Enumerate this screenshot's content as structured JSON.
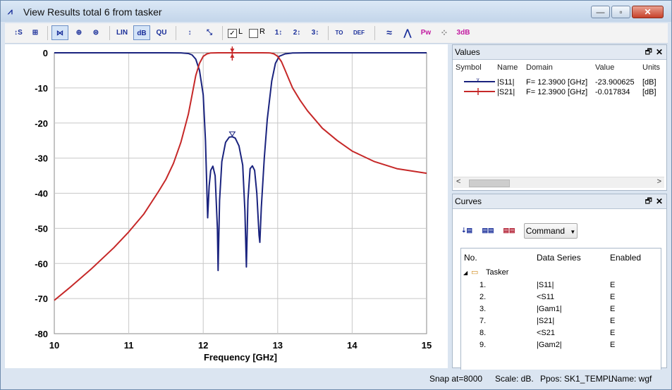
{
  "window": {
    "title": "View Results total 6 from tasker",
    "minimize_glyph": "—",
    "maximize_glyph": "▫",
    "close_glyph": "✕"
  },
  "toolbar": {
    "buttons": [
      {
        "icon": "axis-settings-icon",
        "label": "↕S"
      },
      {
        "icon": "zoom-fit-icon",
        "label": "⊞"
      },
      {
        "icon": "xy-plot-icon",
        "label": "⋈"
      },
      {
        "icon": "polar-plot-icon",
        "label": "⊕"
      },
      {
        "icon": "smith-chart-icon",
        "label": "⊜"
      },
      {
        "icon": "scale-linear-icon",
        "label": "LIN"
      },
      {
        "icon": "scale-db-icon",
        "label": "dB"
      },
      {
        "icon": "scale-unit-icon",
        "label": "QU"
      },
      {
        "icon": "marker-add-icon",
        "label": "↕"
      },
      {
        "icon": "marker-fit-icon",
        "label": "⤡"
      },
      {
        "icon": "marker-1-icon",
        "label": "1↕"
      },
      {
        "icon": "marker-2-icon",
        "label": "2↕"
      },
      {
        "icon": "marker-3-icon",
        "label": "3↕"
      },
      {
        "icon": "marker-to-icon",
        "label": "TO"
      },
      {
        "icon": "marker-def-icon",
        "label": "DEF"
      },
      {
        "icon": "wave-icon",
        "label": "≈"
      },
      {
        "icon": "peaks-icon",
        "label": "⋀"
      },
      {
        "icon": "power-wave-icon",
        "label": "Pw"
      },
      {
        "icon": "dots-icon",
        "label": "⁘"
      },
      {
        "icon": "3db-icon",
        "label": "3dB"
      }
    ],
    "check_l": {
      "label": "L",
      "checked": true,
      "mark": "✓"
    },
    "check_r": {
      "label": "R",
      "checked": false,
      "mark": ""
    }
  },
  "chart_data": {
    "type": "line",
    "xlabel": "Frequency [GHz]",
    "ylabel": "",
    "xlim": [
      10,
      15
    ],
    "ylim": [
      -80,
      0
    ],
    "xticks": [
      "10",
      "11",
      "12",
      "13",
      "14",
      "15"
    ],
    "yticks": [
      "0",
      "-10",
      "-20",
      "-30",
      "-40",
      "-50",
      "-60",
      "-70",
      "-80"
    ],
    "grid": true,
    "marker_x": 12.39,
    "series": [
      {
        "name": "|S11|",
        "color": "#1a237e",
        "x": [
          10.0,
          11.5,
          11.7,
          11.8,
          11.85,
          11.9,
          11.95,
          12.0,
          12.03,
          12.06,
          12.08,
          12.1,
          12.13,
          12.16,
          12.19,
          12.2,
          12.22,
          12.25,
          12.3,
          12.35,
          12.39,
          12.43,
          12.48,
          12.53,
          12.56,
          12.58,
          12.6,
          12.63,
          12.66,
          12.69,
          12.72,
          12.75,
          12.76,
          12.78,
          12.82,
          12.86,
          12.92,
          12.97,
          13.02,
          13.1,
          13.2,
          13.4,
          14.0,
          15.0
        ],
        "y": [
          0.0,
          0.0,
          -0.02,
          -0.2,
          -0.6,
          -1.8,
          -5.0,
          -12.0,
          -25.0,
          -47.0,
          -38.0,
          -33.5,
          -32.3,
          -35.0,
          -50.0,
          -62.0,
          -42.0,
          -31.0,
          -25.5,
          -24.0,
          -23.9,
          -24.3,
          -26.5,
          -32.0,
          -45.0,
          -61.0,
          -42.0,
          -33.0,
          -32.2,
          -33.5,
          -40.0,
          -52.0,
          -54.0,
          -44.0,
          -30.0,
          -19.0,
          -8.0,
          -3.0,
          -1.0,
          -0.3,
          -0.06,
          -0.01,
          0.0,
          0.0
        ]
      },
      {
        "name": "|S21|",
        "color": "#c62828",
        "x": [
          10.0,
          10.2,
          10.5,
          10.8,
          11.0,
          11.2,
          11.4,
          11.5,
          11.6,
          11.7,
          11.8,
          11.85,
          11.9,
          11.95,
          12.0,
          12.05,
          12.1,
          12.2,
          12.8,
          12.9,
          12.95,
          13.0,
          13.05,
          13.1,
          13.15,
          13.2,
          13.3,
          13.4,
          13.6,
          13.8,
          14.0,
          14.3,
          14.6,
          15.0
        ],
        "y": [
          -70.5,
          -67.0,
          -61.5,
          -55.5,
          -51.0,
          -46.0,
          -39.5,
          -36.0,
          -31.5,
          -25.5,
          -17.5,
          -12.0,
          -6.5,
          -3.0,
          -1.0,
          -0.3,
          -0.05,
          0.0,
          0.0,
          -0.05,
          -0.3,
          -1.0,
          -2.5,
          -5.0,
          -7.5,
          -10.0,
          -13.5,
          -16.5,
          -21.5,
          -25.0,
          -28.0,
          -31.0,
          -33.0,
          -34.3
        ]
      }
    ]
  },
  "values_panel": {
    "title": "Values",
    "columns": [
      "Symbol",
      "Name",
      "Domain",
      "Value",
      "Units"
    ],
    "rows": [
      {
        "name": "|S11|",
        "domain": "F= 12.3900 [GHz]",
        "value": "-23.900625",
        "units": "[dB]",
        "color": "#1a237e"
      },
      {
        "name": "|S21|",
        "domain": "F= 12.3900 [GHz]",
        "value": "-0.017834",
        "units": "[dB]",
        "color": "#c62828"
      }
    ],
    "pin_glyph": "🗗",
    "close_glyph": "✕",
    "scroll_left": "<",
    "scroll_right": ">"
  },
  "curves_panel": {
    "title": "Curves",
    "command_label": "Command",
    "command_arrow": "▼",
    "pin_glyph": "🗗",
    "close_glyph": "✕",
    "columns": [
      "No.",
      "Data Series",
      "Enabled"
    ],
    "folder": {
      "expander": "◢",
      "name": "Tasker"
    },
    "rows": [
      {
        "no": "1.",
        "series": "|S11|",
        "enabled": "E"
      },
      {
        "no": "2.",
        "series": "<S11",
        "enabled": "E"
      },
      {
        "no": "3.",
        "series": "|Gam1|",
        "enabled": "E"
      },
      {
        "no": "7.",
        "series": "|S21|",
        "enabled": "E"
      },
      {
        "no": "8.",
        "series": "<S21",
        "enabled": "E"
      },
      {
        "no": "9.",
        "series": "|Gam2|",
        "enabled": "E"
      }
    ],
    "scroll_left": "<",
    "scroll_right": ">"
  },
  "status": {
    "snap": "Snap at=8000",
    "scale": "Scale: dB.",
    "ppos": "Ppos: SK1_TEMPL",
    "name": "Name: wgf"
  }
}
